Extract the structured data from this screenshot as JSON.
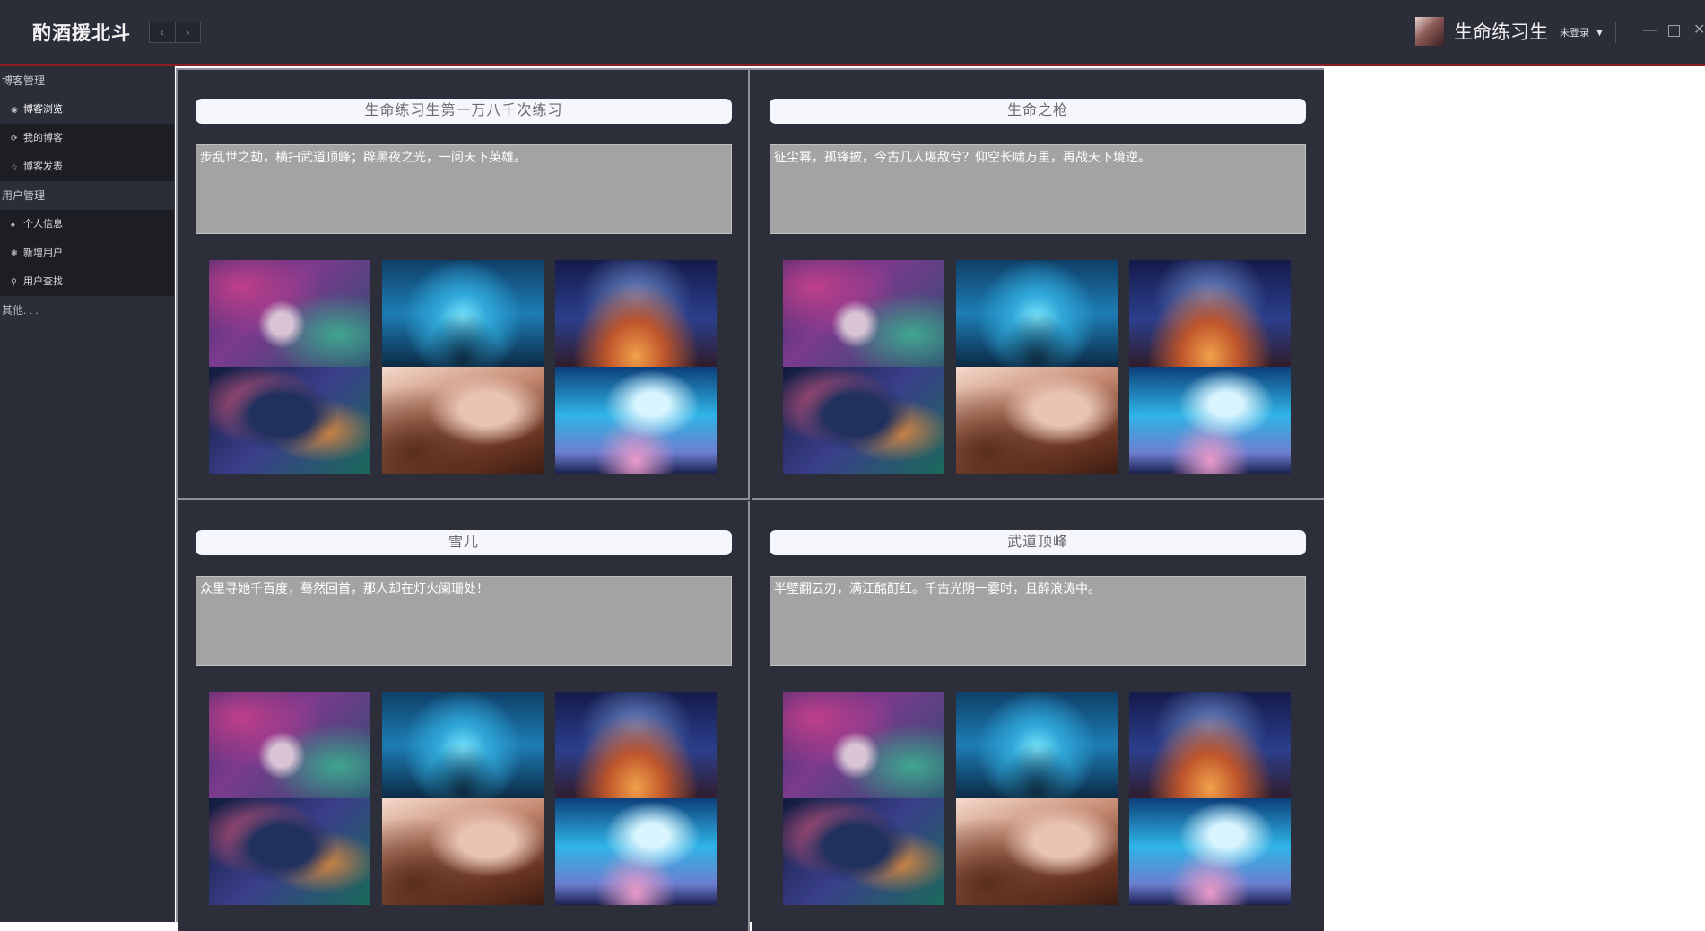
{
  "app": {
    "title": "酌酒援北斗",
    "nav_back": "‹",
    "nav_forward": "›"
  },
  "user": {
    "name": "生命练习生",
    "status": "未登录",
    "caret": "▼"
  },
  "window_controls": {
    "minimize": "—",
    "close": "✕"
  },
  "sidebar": {
    "groups": [
      {
        "header": "博客管理",
        "items": [
          {
            "icon": "circle-icon",
            "glyph": "◉",
            "label": "博客浏览",
            "active": true
          },
          {
            "icon": "refresh-icon",
            "glyph": "⟳",
            "label": "我的博客",
            "active": false
          },
          {
            "icon": "star-icon",
            "glyph": "☆",
            "label": "博客发表",
            "active": false
          }
        ]
      },
      {
        "header": "用户管理",
        "items": [
          {
            "icon": "person-icon",
            "glyph": "♠",
            "label": "个人信息",
            "active": false
          },
          {
            "icon": "add-user-icon",
            "glyph": "❃",
            "label": "新增用户",
            "active": false
          },
          {
            "icon": "search-icon",
            "glyph": "⚲",
            "label": "用户查找",
            "active": false
          }
        ]
      }
    ],
    "other": "其他. . ."
  },
  "posts": [
    {
      "title": "生命练习生第一万八千次练习",
      "body": "步乱世之劫，横扫武道顶峰；辟黑夜之光，一问天下英雄。"
    },
    {
      "title": "生命之枪",
      "body": "征尘幂，孤锋披，今古几人堪敌兮？仰空长啸万里，再战天下境逆。"
    },
    {
      "title": "雪儿",
      "body": "众里寻她千百度，蓦然回首，那人却在灯火阑珊处！"
    },
    {
      "title": "武道顶峰",
      "body": "半壁翻云刃，满江酩酊红。千古光阴一霎时，且醉浪涛中。"
    }
  ],
  "gallery_images": [
    "galaxy-whale-image",
    "underwater-couple-image",
    "starry-horizon-image",
    "cosmic-eye-image",
    "sleeping-girl-image",
    "sky-whale-image"
  ],
  "colors": {
    "titlebar": "#2b2d38",
    "accent_line": "#8b1e22",
    "content_bg": "#2c2e3a",
    "textarea_bg": "#a3a3a3",
    "title_pill": "#f4f6fc"
  }
}
